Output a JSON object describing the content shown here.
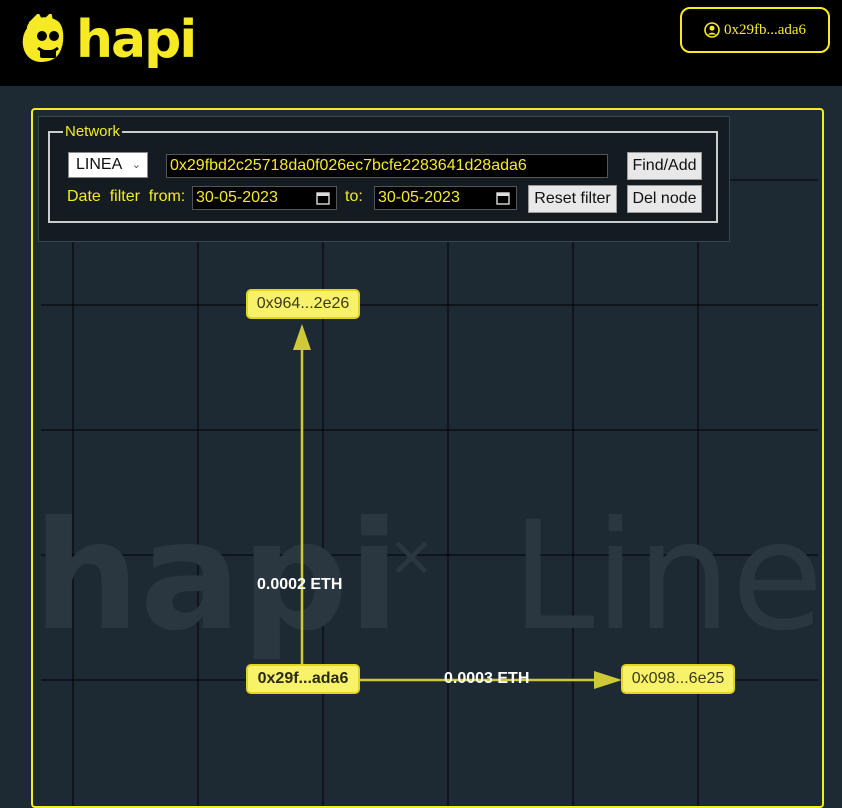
{
  "header": {
    "logo_text": "hapi",
    "wallet_label": "0x29fb...ada6"
  },
  "panel": {
    "legend": "Network",
    "network_select": "LINEA",
    "address_value": "0x29fbd2c25718da0f026ec7bcfe2283641d28ada6",
    "find_add_label": "Find/Add",
    "date_filter_label": "Date  filter  from:",
    "date_from": "30-05-2023",
    "to_label": "to:",
    "date_to": "30-05-2023",
    "reset_filter_label": "Reset filter",
    "del_node_label": "Del node"
  },
  "watermark": {
    "left": "hapi",
    "cross": "×",
    "right": "Linea"
  },
  "graph": {
    "nodes": {
      "top": "0x964...2e26",
      "center": "0x29f...ada6",
      "right": "0x098...6e25"
    },
    "edges": {
      "center_to_top": "0.0002 ETH",
      "center_to_right": "0.0003 ETH"
    }
  },
  "colors": {
    "accent": "#f6ea25",
    "background": "#1e2a33",
    "node_fill": "#f7f26a",
    "edge": "#cfc93a"
  }
}
